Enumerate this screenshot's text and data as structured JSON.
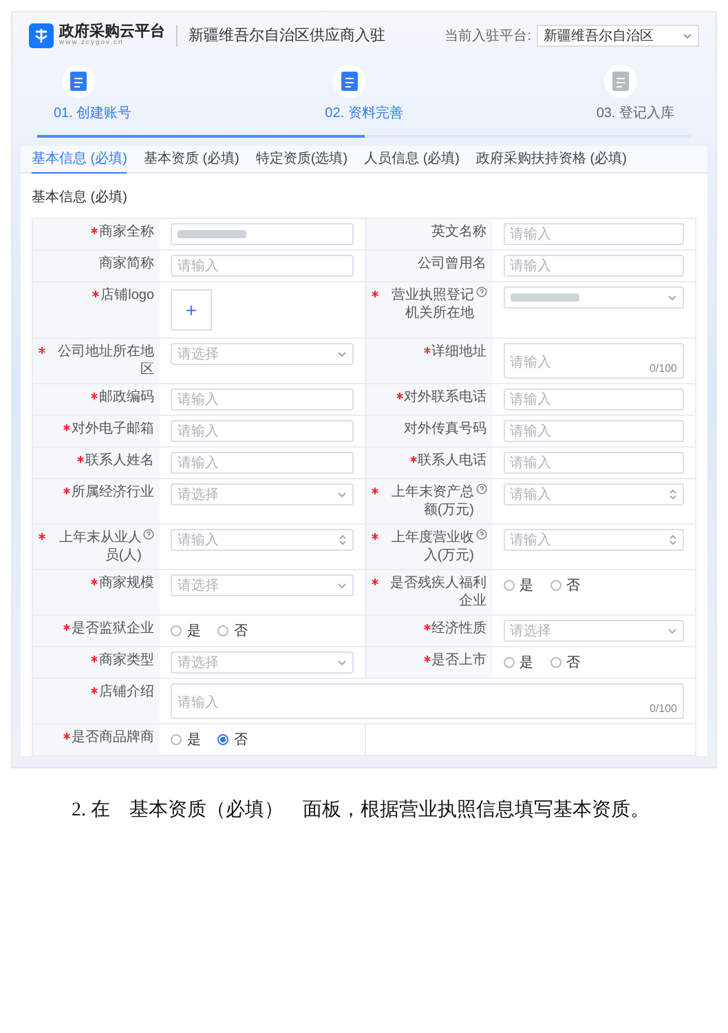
{
  "header": {
    "logo_title": "政府采购云平台",
    "logo_url": "www.zcygov.cn",
    "page_title": "新疆维吾尔自治区供应商入驻",
    "platform_label": "当前入驻平台:",
    "platform_value": "新疆维吾尔自治区"
  },
  "steps": [
    {
      "label": "01. 创建账号",
      "reached": true
    },
    {
      "label": "02. 资料完善",
      "reached": true
    },
    {
      "label": "03. 登记入库",
      "reached": false
    }
  ],
  "step_progress": {
    "level": 0.5
  },
  "tabs": [
    {
      "label": "基本信息 (必填)",
      "selected": true
    },
    {
      "label": "基本资质 (必填)",
      "selected": false
    },
    {
      "label": "特定资质(选填)",
      "selected": false
    },
    {
      "label": "人员信息 (必填)",
      "selected": false
    },
    {
      "label": "政府采购扶持资格 (必填)",
      "selected": false
    }
  ],
  "section_title": "基本信息 (必填)",
  "rows": [
    [
      {
        "label": "商家全称",
        "required": true,
        "kind": "input",
        "redacted": true
      },
      {
        "label": "英文名称",
        "required": false,
        "kind": "input",
        "placeholder": "请输入"
      }
    ],
    [
      {
        "label": "商家简称",
        "required": false,
        "kind": "input",
        "placeholder": "请输入"
      },
      {
        "label": "公司曾用名",
        "required": false,
        "kind": "input",
        "placeholder": "请输入"
      }
    ],
    [
      {
        "label": "店铺logo",
        "required": true,
        "kind": "upload",
        "button": "+"
      },
      {
        "label": "营业执照登记机关所在地",
        "required": true,
        "info": true,
        "kind": "select",
        "redacted": true
      }
    ],
    [
      {
        "label": "公司地址所在地区",
        "required": true,
        "kind": "select",
        "placeholder": "请选择"
      },
      {
        "label": "详细地址",
        "required": true,
        "kind": "textarea",
        "placeholder": "请输入",
        "counter": "0/100"
      }
    ],
    [
      {
        "label": "邮政编码",
        "required": true,
        "kind": "input",
        "placeholder": "请输入"
      },
      {
        "label": "对外联系电话",
        "required": true,
        "kind": "input",
        "placeholder": "请输入"
      }
    ],
    [
      {
        "label": "对外电子邮箱",
        "required": true,
        "kind": "input",
        "placeholder": "请输入"
      },
      {
        "label": "对外传真号码",
        "required": false,
        "kind": "input",
        "placeholder": "请输入"
      }
    ],
    [
      {
        "label": "联系人姓名",
        "required": true,
        "kind": "input",
        "placeholder": "请输入"
      },
      {
        "label": "联系人电话",
        "required": true,
        "kind": "input",
        "placeholder": "请输入"
      }
    ],
    [
      {
        "label": "所属经济行业",
        "required": true,
        "kind": "select",
        "placeholder": "请选择"
      },
      {
        "label": "上年末资产总额(万元)",
        "required": true,
        "info": true,
        "kind": "number",
        "placeholder": "请输入"
      }
    ],
    [
      {
        "label": "上年末从业人员(人)",
        "required": true,
        "info": true,
        "kind": "number",
        "placeholder": "请输入"
      },
      {
        "label": "上年度营业收入(万元)",
        "required": true,
        "info": true,
        "kind": "number",
        "placeholder": "请输入"
      }
    ],
    [
      {
        "label": "商家规模",
        "required": true,
        "kind": "select",
        "placeholder": "请选择"
      },
      {
        "label": "是否残疾人福利企业",
        "required": true,
        "kind": "radio",
        "options": [
          {
            "label": "是",
            "selected": false
          },
          {
            "label": "否",
            "selected": false
          }
        ]
      }
    ],
    [
      {
        "label": "是否监狱企业",
        "required": true,
        "kind": "radio",
        "options": [
          {
            "label": "是",
            "selected": false
          },
          {
            "label": "否",
            "selected": false
          }
        ]
      },
      {
        "label": "经济性质",
        "required": true,
        "kind": "select",
        "placeholder": "请选择"
      }
    ],
    [
      {
        "label": "商家类型",
        "required": true,
        "kind": "select",
        "placeholder": "请选择"
      },
      {
        "label": "是否上市",
        "required": true,
        "kind": "radio",
        "options": [
          {
            "label": "是",
            "selected": false
          },
          {
            "label": "否",
            "selected": false
          }
        ]
      }
    ],
    [
      {
        "label": "店铺介绍",
        "required": true,
        "kind": "textarea",
        "placeholder": "请输入",
        "counter": "0/100"
      }
    ],
    [
      {
        "label": "是否商品牌商",
        "required": true,
        "kind": "radio",
        "options": [
          {
            "label": "是",
            "selected": false
          },
          {
            "label": "否",
            "selected": true
          }
        ]
      },
      {
        "kind": "blank"
      }
    ]
  ],
  "paragraph": "2. 在　基本资质（必填）　面板，根据营业执照信息填写基本资质。"
}
